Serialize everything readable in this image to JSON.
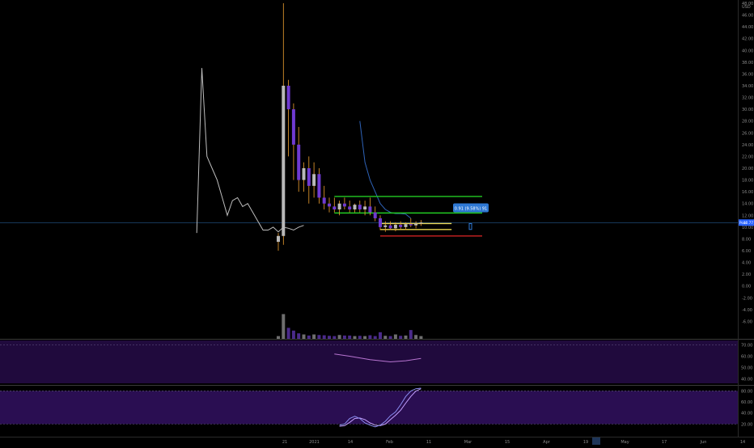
{
  "chart_data": {
    "type": "candlestick",
    "title": "",
    "price_axis": {
      "currency": "USD",
      "ylim": [
        -8,
        48
      ],
      "ticks": [
        "48.00",
        "46.00",
        "44.00",
        "42.00",
        "40.00",
        "38.00",
        "36.00",
        "34.00",
        "32.00",
        "30.00",
        "28.00",
        "26.00",
        "24.00",
        "22.00",
        "20.00",
        "18.00",
        "16.00",
        "14.00",
        "12.00",
        "10.00",
        "8.00",
        "6.00",
        "4.00",
        "2.00",
        "0.00",
        "-2.00",
        "-4.00",
        "-6.00"
      ]
    },
    "time_axis": {
      "labels": [
        "21",
        "2021",
        "14",
        "Feb",
        "11",
        "Mar",
        "15",
        "Apr",
        "19",
        "May",
        "17",
        "Jun",
        "14",
        "Jul"
      ],
      "highlighted_label": "19"
    },
    "price_tag": {
      "label": "Pool",
      "value": "10.77"
    },
    "measure_label": "0.91 (9.58%) 91",
    "candles": [
      {
        "t": 0,
        "o": 7.5,
        "h": 9,
        "l": 6,
        "c": 8.5
      },
      {
        "t": 1,
        "o": 8.5,
        "h": 48,
        "l": 7,
        "c": 34
      },
      {
        "t": 2,
        "o": 34,
        "h": 35,
        "l": 22,
        "c": 30
      },
      {
        "t": 3,
        "o": 30,
        "h": 31,
        "l": 18,
        "c": 24
      },
      {
        "t": 4,
        "o": 24,
        "h": 27,
        "l": 16,
        "c": 18
      },
      {
        "t": 5,
        "o": 18,
        "h": 21,
        "l": 16,
        "c": 20
      },
      {
        "t": 6,
        "o": 20,
        "h": 22,
        "l": 14,
        "c": 17
      },
      {
        "t": 7,
        "o": 17,
        "h": 21,
        "l": 15,
        "c": 19
      },
      {
        "t": 8,
        "o": 19,
        "h": 20,
        "l": 14,
        "c": 15
      },
      {
        "t": 9,
        "o": 15,
        "h": 17,
        "l": 13,
        "c": 14
      },
      {
        "t": 10,
        "o": 14,
        "h": 15,
        "l": 12.5,
        "c": 13.5
      },
      {
        "t": 11,
        "o": 13.5,
        "h": 15,
        "l": 12.5,
        "c": 13
      },
      {
        "t": 12,
        "o": 13,
        "h": 14.5,
        "l": 12,
        "c": 14
      },
      {
        "t": 13,
        "o": 14,
        "h": 15,
        "l": 13,
        "c": 13.5
      },
      {
        "t": 14,
        "o": 13.5,
        "h": 14.5,
        "l": 12.5,
        "c": 13
      },
      {
        "t": 15,
        "o": 13,
        "h": 14,
        "l": 12.5,
        "c": 13.8
      },
      {
        "t": 16,
        "o": 13.8,
        "h": 14.5,
        "l": 12.5,
        "c": 13
      },
      {
        "t": 17,
        "o": 13,
        "h": 14.5,
        "l": 12,
        "c": 13.5
      },
      {
        "t": 18,
        "o": 13.5,
        "h": 15,
        "l": 12,
        "c": 12.5
      },
      {
        "t": 19,
        "o": 12.5,
        "h": 13.5,
        "l": 11,
        "c": 11.5
      },
      {
        "t": 20,
        "o": 11.5,
        "h": 12,
        "l": 9.5,
        "c": 10
      },
      {
        "t": 21,
        "o": 10,
        "h": 11,
        "l": 9.2,
        "c": 10.3
      },
      {
        "t": 22,
        "o": 10.3,
        "h": 11,
        "l": 9.5,
        "c": 9.8
      },
      {
        "t": 23,
        "o": 9.8,
        "h": 10.8,
        "l": 9.3,
        "c": 10.4
      },
      {
        "t": 24,
        "o": 10.4,
        "h": 11,
        "l": 9.6,
        "c": 10
      },
      {
        "t": 25,
        "o": 10,
        "h": 10.8,
        "l": 9.5,
        "c": 10.5
      },
      {
        "t": 26,
        "o": 10.5,
        "h": 11.5,
        "l": 10,
        "c": 10.3
      },
      {
        "t": 27,
        "o": 10.3,
        "h": 11,
        "l": 9.8,
        "c": 10.6
      },
      {
        "t": 28,
        "o": 10.6,
        "h": 11.2,
        "l": 10.2,
        "c": 10.77
      }
    ],
    "volume": [
      1,
      9,
      4,
      3,
      2,
      1.6,
      1.2,
      1.6,
      1.4,
      1.3,
      1.1,
      1,
      1.4,
      1.2,
      1.2,
      1,
      1.1,
      1,
      1.3,
      1,
      2.4,
      1.1,
      1,
      1.6,
      1.1,
      1.2,
      3.2,
      1.4,
      1
    ],
    "comparison_line": {
      "name": "",
      "points": [
        [
          -16,
          9
        ],
        [
          -15,
          37
        ],
        [
          -14,
          22
        ],
        [
          -13,
          20
        ],
        [
          -12,
          18
        ],
        [
          -11,
          15
        ],
        [
          -10,
          12
        ],
        [
          -9,
          14.5
        ],
        [
          -8,
          15
        ],
        [
          -7,
          13.5
        ],
        [
          -6,
          14
        ],
        [
          -5,
          12.5
        ],
        [
          -4,
          11
        ],
        [
          -3,
          9.5
        ],
        [
          -2,
          9.5
        ],
        [
          -1,
          10
        ],
        [
          0,
          9.2
        ],
        [
          1,
          10
        ],
        [
          2,
          9.8
        ],
        [
          3,
          9.5
        ],
        [
          4,
          10
        ],
        [
          5,
          10.3
        ]
      ]
    },
    "ma_line": {
      "name": "",
      "points": [
        [
          16,
          28
        ],
        [
          17,
          21
        ],
        [
          18,
          18
        ],
        [
          19,
          16
        ],
        [
          20,
          14
        ],
        [
          21,
          13
        ],
        [
          22,
          12.5
        ],
        [
          23,
          12.3
        ],
        [
          24,
          12.3
        ],
        [
          25,
          12.2
        ],
        [
          26,
          11.5
        ]
      ]
    },
    "horizontal_lines": [
      {
        "name": "resistance-upper",
        "value": 15.2,
        "from": 11,
        "to": 40,
        "color": "#22cc22"
      },
      {
        "name": "resistance-lower",
        "value": 12.4,
        "from": 11,
        "to": 40,
        "color": "#22cc22"
      },
      {
        "name": "range-top",
        "value": 10.6,
        "from": 20,
        "to": 34,
        "color": "#e8d44d"
      },
      {
        "name": "range-bottom",
        "value": 9.6,
        "from": 20,
        "to": 34,
        "color": "#e8d44d"
      },
      {
        "name": "stop-line",
        "value": 8.5,
        "from": 20,
        "to": 40,
        "color": "#cc2222"
      }
    ],
    "last_price_line": 10.77,
    "rsi_panel": {
      "ticks": [
        "70.00",
        "60.00",
        "50.00",
        "40.00"
      ],
      "ylim": [
        36,
        74
      ],
      "band": [
        30,
        70
      ],
      "values": [
        [
          11,
          62
        ],
        [
          14,
          60
        ],
        [
          18,
          57
        ],
        [
          22,
          55
        ],
        [
          25,
          56
        ],
        [
          28,
          58
        ]
      ]
    },
    "stoch_panel": {
      "ticks": [
        "80.00",
        "60.00",
        "40.00",
        "20.00"
      ],
      "ylim": [
        0,
        88
      ],
      "band": [
        20,
        80
      ],
      "k": [
        [
          6,
          18
        ],
        [
          7,
          20
        ],
        [
          8,
          30
        ],
        [
          9,
          34
        ],
        [
          10,
          30
        ],
        [
          11,
          22
        ],
        [
          12,
          18
        ],
        [
          13,
          15
        ],
        [
          14,
          18
        ],
        [
          15,
          25
        ],
        [
          16,
          35
        ],
        [
          17,
          42
        ],
        [
          18,
          55
        ],
        [
          19,
          70
        ],
        [
          20,
          80
        ],
        [
          21,
          84
        ],
        [
          22,
          85
        ]
      ],
      "d": [
        [
          6,
          16
        ],
        [
          7,
          17
        ],
        [
          8,
          23
        ],
        [
          9,
          30
        ],
        [
          10,
          31
        ],
        [
          11,
          28
        ],
        [
          12,
          22
        ],
        [
          13,
          18
        ],
        [
          14,
          17
        ],
        [
          15,
          20
        ],
        [
          16,
          28
        ],
        [
          17,
          36
        ],
        [
          18,
          45
        ],
        [
          19,
          58
        ],
        [
          20,
          70
        ],
        [
          21,
          80
        ],
        [
          22,
          84
        ]
      ]
    },
    "colors": {
      "background": "#000000",
      "candle_up": "#b9b9b9",
      "candle_down": "#6f3ad1",
      "wick_orange": "#f0a030",
      "comparison_line": "#bdbdbd",
      "ma_line": "#2f63b8",
      "indicator_bg": "#200a3d",
      "rsi_line": "#b774d0",
      "stoch_k": "#8a8cf0",
      "stoch_d": "#c4a0ff",
      "axis_text": "#8c8c8c",
      "price_tag_bg": "#2962ff",
      "measure_bg": "#2e78d3"
    }
  }
}
